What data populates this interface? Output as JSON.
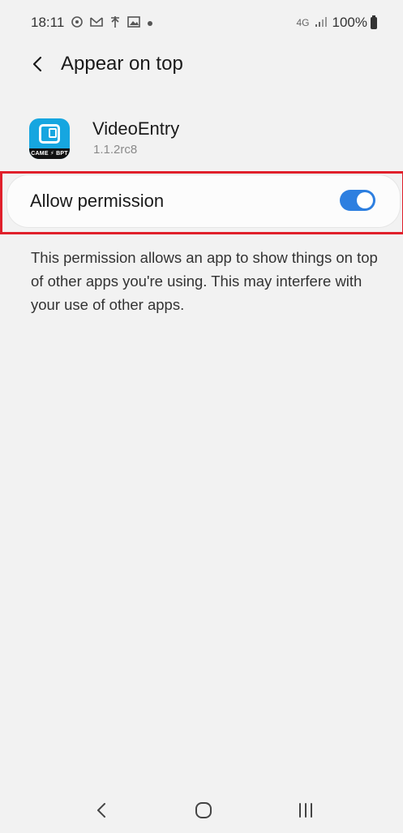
{
  "status_bar": {
    "time": "18:11",
    "network": "4G",
    "battery": "100%"
  },
  "header": {
    "title": "Appear on top"
  },
  "app": {
    "name": "VideoEntry",
    "version": "1.1.2rc8",
    "icon_brand": "CAME ⚡ BPT"
  },
  "permission": {
    "label": "Allow permission",
    "enabled": true,
    "toggle_color": "#2d7fe0"
  },
  "description": "This permission allows an app to show things on top of other apps you're using. This may interfere with your use of other apps.",
  "highlight_color": "#e0202b"
}
